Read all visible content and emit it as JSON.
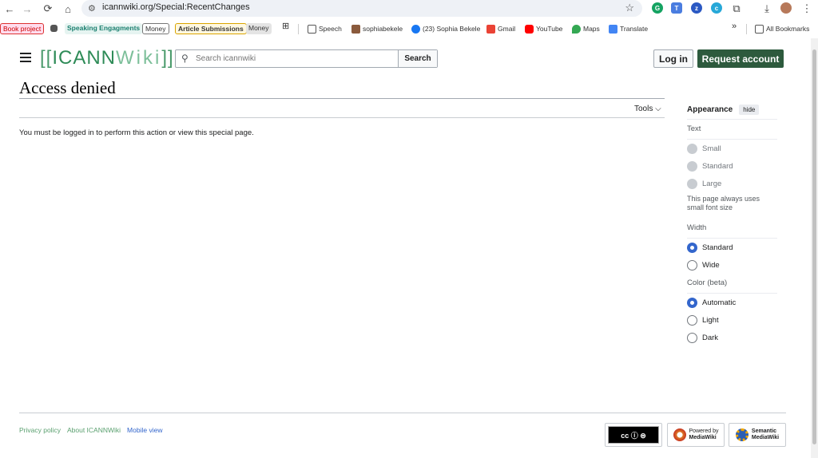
{
  "browser": {
    "url": "icannwiki.org/Special:RecentChanges",
    "back_glyph": "←",
    "forward_glyph": "→",
    "reload_glyph": "⟳",
    "home_glyph": "⌂",
    "star_glyph": "☆",
    "download_glyph": "⤓",
    "menu_glyph": "⋮",
    "ext_glyph": "⧉"
  },
  "bookmarks": {
    "book_project": "Book project",
    "speaking": "Speaking Engagments",
    "money1": "Money",
    "article": "Article Submissions",
    "money2": "Money",
    "apps_glyph": "⊞",
    "speech": "Speech",
    "sophia": "sophiabekele",
    "fb": "(23) Sophia Bekele",
    "gmail": "Gmail",
    "youtube": "YouTube",
    "maps": "Maps",
    "translate": "Translate",
    "more_glyph": "»",
    "all": "All Bookmarks"
  },
  "header": {
    "logo_open": "[[",
    "logo_icann": "ICANN",
    "logo_wiki": "Wiki",
    "logo_close": "]]",
    "search_placeholder": "Search icannwiki",
    "search_button": "Search",
    "login": "Log in",
    "request": "Request account"
  },
  "main": {
    "title": "Access denied",
    "tools": "Tools",
    "tools_chevron": "⌵",
    "message": "You must be logged in to perform this action or view this special page."
  },
  "appearance": {
    "title": "Appearance",
    "hide": "hide",
    "text_label": "Text",
    "text_options": [
      "Small",
      "Standard",
      "Large"
    ],
    "text_note": "This page always uses small font size",
    "width_label": "Width",
    "width_options": [
      "Standard",
      "Wide"
    ],
    "width_selected": "Standard",
    "color_label": "Color (beta)",
    "color_options": [
      "Automatic",
      "Light",
      "Dark"
    ],
    "color_selected": "Automatic"
  },
  "footer": {
    "links": [
      "Privacy policy",
      "About ICANNWiki",
      "Mobile view"
    ],
    "cc_text": "cc ⓘ ⊜",
    "cc_sub": "BY  SA",
    "powered_by": "Powered by",
    "mediawiki": "MediaWiki",
    "semantic": "Semantic",
    "semantic_mw": "MediaWiki"
  },
  "colors": {
    "accent": "#3366cc",
    "request_bg": "#2d5a3d",
    "logo": "#2e8b57"
  }
}
